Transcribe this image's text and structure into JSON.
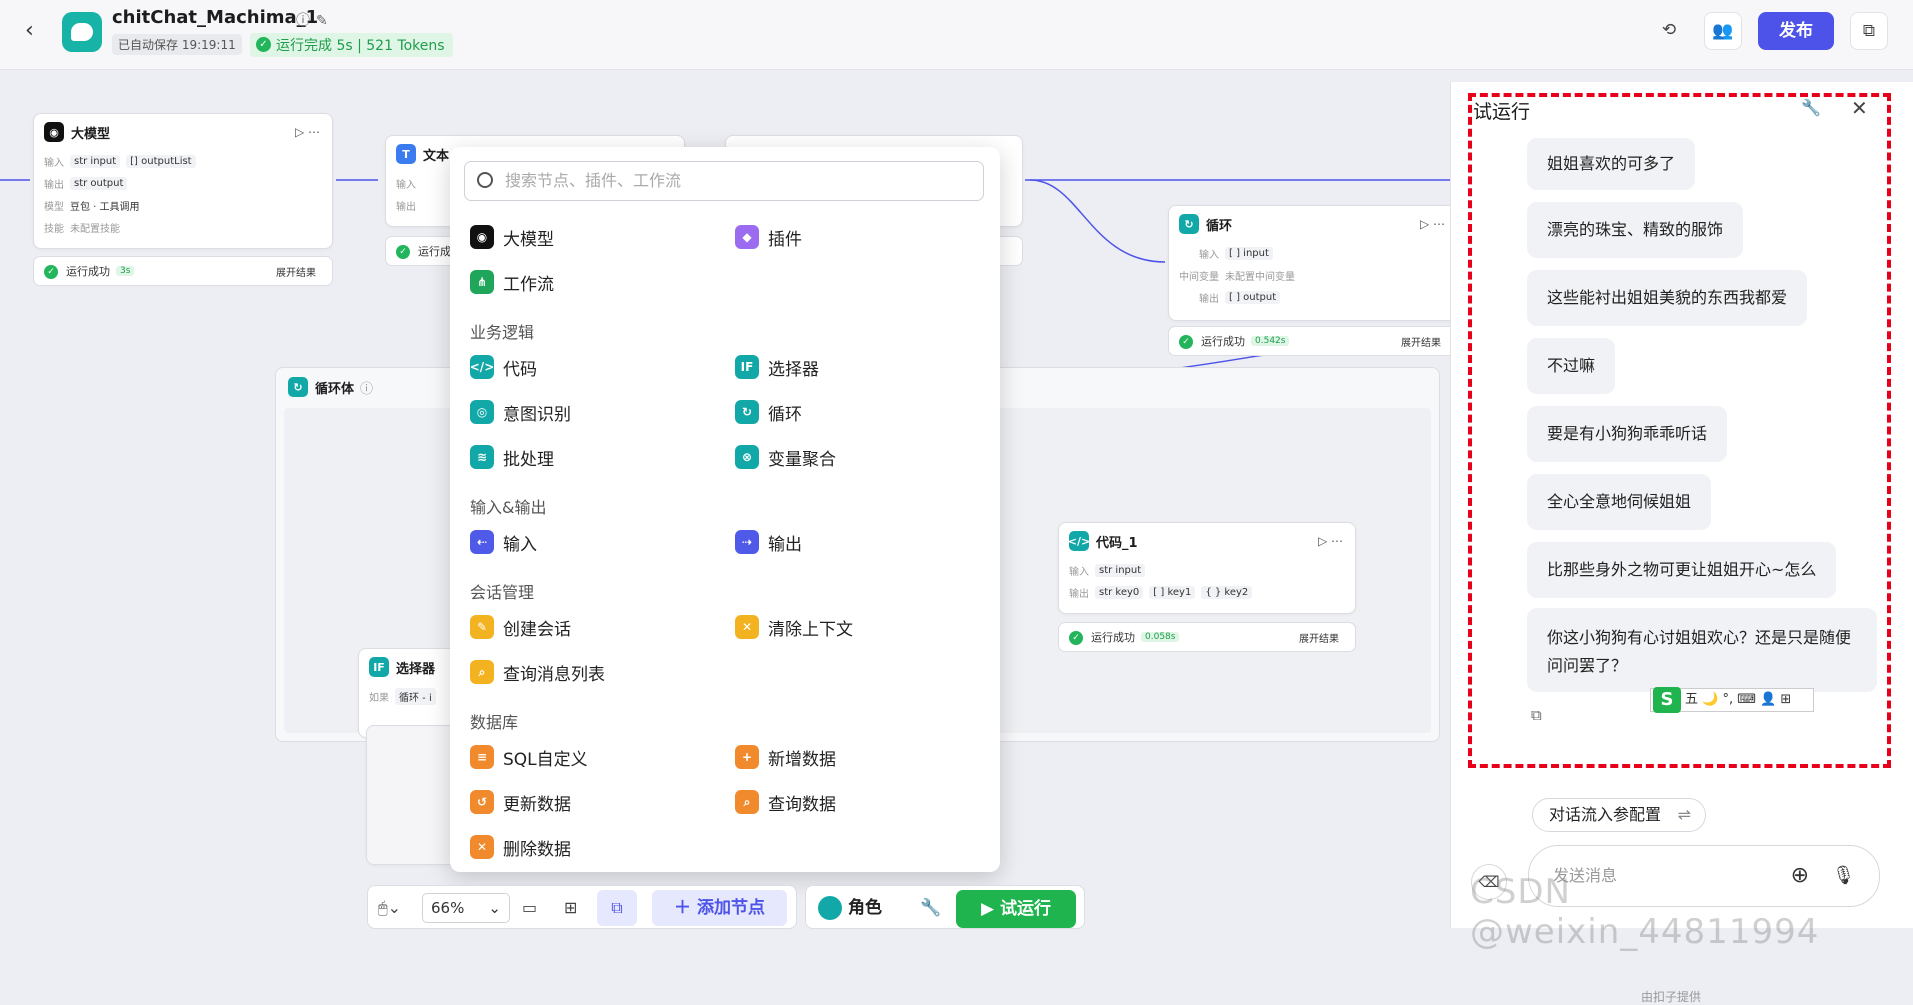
{
  "header": {
    "title": "chitChat_Machima_1",
    "saved": "已自动保存 19:19:11",
    "run_status": "运行完成 5s | 521 Tokens",
    "publish": "发布"
  },
  "nodes": {
    "llm": {
      "title": "大模型",
      "in_label": "输入",
      "in_tag1": "str input",
      "in_tag2": "[] outputList",
      "out_label": "输出",
      "out_tag": "str output",
      "model_label": "模型",
      "model_value": "豆包 · 工具调用",
      "skill_label": "技能",
      "skill_value": "未配置技能",
      "status": "运行成功",
      "time": "3s",
      "expand": "展开结果"
    },
    "text": {
      "title": "文本",
      "in_label": "输入",
      "out_label": "输出",
      "status": "运行成功"
    },
    "loop": {
      "title": "循环",
      "in_label": "输入",
      "in_tag": "[ ] input",
      "mid_label": "中间变量",
      "mid_value": "未配置中间变量",
      "out_label": "输出",
      "out_tag": "[ ] output",
      "status": "运行成功",
      "time": "0.542s",
      "expand": "展开结果"
    },
    "loopbody": {
      "title": "循环体"
    },
    "code1": {
      "title": "代码_1",
      "in_label": "输入",
      "in_tag": "str input",
      "out_label": "输出",
      "out_tag1": "str key0",
      "out_tag2": "[ ] key1",
      "out_tag3": "{ } key2",
      "status": "运行成功",
      "time": "0.058s",
      "expand": "展开结果"
    },
    "selector": {
      "title": "选择器",
      "if_label": "如果",
      "if_value": "循环 - i"
    }
  },
  "menu": {
    "search_placeholder": "搜索节点、插件、工作流",
    "top": [
      "大模型",
      "插件",
      "工作流"
    ],
    "sections": [
      "业务逻辑",
      "输入&输出",
      "会话管理",
      "数据库"
    ],
    "logic": [
      "代码",
      "选择器",
      "意图识别",
      "循环",
      "批处理",
      "变量聚合"
    ],
    "io": [
      "输入",
      "输出"
    ],
    "session": [
      "创建会话",
      "清除上下文",
      "查询消息列表"
    ],
    "db": [
      "SQL自定义",
      "新增数据",
      "更新数据",
      "查询数据",
      "删除数据"
    ]
  },
  "toolbar": {
    "zoom": "66%",
    "add_node": "添加节点",
    "role": "角色",
    "trial_run": "试运行"
  },
  "panel": {
    "title": "试运行",
    "messages": [
      "姐姐喜欢的可多了",
      "漂亮的珠宝、精致的服饰",
      "这些能衬出姐姐美貌的东西我都爱",
      "不过嘛",
      "要是有小狗狗乖乖听话",
      "全心全意地伺候姐姐",
      "比那些身外之物可更让姐姐开心~怎么",
      "你这小狗狗有心讨姐姐欢心？还是只是随便问问罢了？"
    ],
    "config_button": "对话流入参配置",
    "input_placeholder": "发送消息",
    "ime_text": "五 🌙 °, ⌨ 👤 ⊞",
    "ime_logo": "S",
    "footer_text": "由扣子提供"
  },
  "watermark": "CSDN @weixin_44811994"
}
